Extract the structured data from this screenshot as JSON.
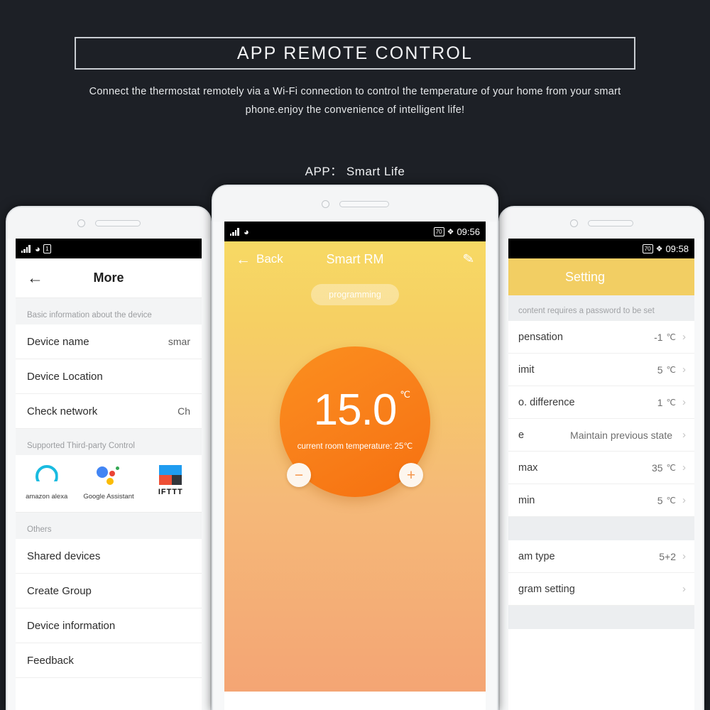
{
  "header": {
    "title": "APP REMOTE CONTROL",
    "subtitle": "Connect the thermostat remotely via a Wi-Fi connection to control the temperature of your home from your smart phone.enjoy the convenience of intelligent life!",
    "app_line": "APP： Smart Life",
    "border_color": "#c9cdd2",
    "background_color": "#1d2026"
  },
  "phone_left": {
    "statusbar": {
      "signal": "signal-icon",
      "wifi": "wifi-icon",
      "sim": "sim-icon"
    },
    "appbar": {
      "back": "←",
      "title": "More"
    },
    "section_basic": "Basic information about the device",
    "rows_basic": [
      {
        "label": "Device name",
        "value": "smar"
      },
      {
        "label": "Device Location",
        "value": ""
      },
      {
        "label": "Check network",
        "value": "Ch"
      }
    ],
    "section_third_party": "Supported Third-party Control",
    "brands": [
      {
        "name": "amazon alexa",
        "icon": "alexa-icon"
      },
      {
        "name": "Google Assistant",
        "icon": "google-assistant-icon"
      },
      {
        "name": "IFTTT",
        "icon": "ifttt-icon"
      }
    ],
    "section_others": "Others",
    "rows_others": [
      {
        "label": "Shared devices"
      },
      {
        "label": "Create Group"
      },
      {
        "label": "Device information"
      },
      {
        "label": "Feedback"
      }
    ]
  },
  "phone_center": {
    "statusbar": {
      "battery": "70",
      "charging": "charging-icon",
      "time": "09:56"
    },
    "appbar": {
      "back_label": "Back",
      "title": "Smart RM",
      "edit": "edit-icon"
    },
    "programming_pill": "programming",
    "dial": {
      "set_temperature": "15.0",
      "unit": "℃",
      "current_room_text": "current room temperature:",
      "current_room_value": "25℃",
      "minus": "−",
      "plus": "+",
      "color": "#f8811b"
    },
    "gradient_top": "#f7d964",
    "gradient_bottom": "#f4a374"
  },
  "phone_right": {
    "statusbar": {
      "battery": "70",
      "charging": "charging-icon",
      "time": "09:58"
    },
    "appbar": {
      "title": "Setting",
      "color": "#f2ce63"
    },
    "note": "content requires a password to be set",
    "rows_group1": [
      {
        "label": "pensation",
        "value": "-1",
        "unit": "℃"
      },
      {
        "label": "imit",
        "value": "5",
        "unit": "℃"
      },
      {
        "label": "o. difference",
        "value": "1",
        "unit": "℃"
      },
      {
        "label": "e",
        "value": "Maintain previous state",
        "unit": ""
      },
      {
        "label": "max",
        "value": "35",
        "unit": "℃"
      },
      {
        "label": "min",
        "value": "5",
        "unit": "℃"
      }
    ],
    "rows_group2": [
      {
        "label": "am type",
        "value": "5+2",
        "unit": ""
      },
      {
        "label": "gram setting",
        "value": "",
        "unit": ""
      }
    ],
    "chevron": "›"
  }
}
